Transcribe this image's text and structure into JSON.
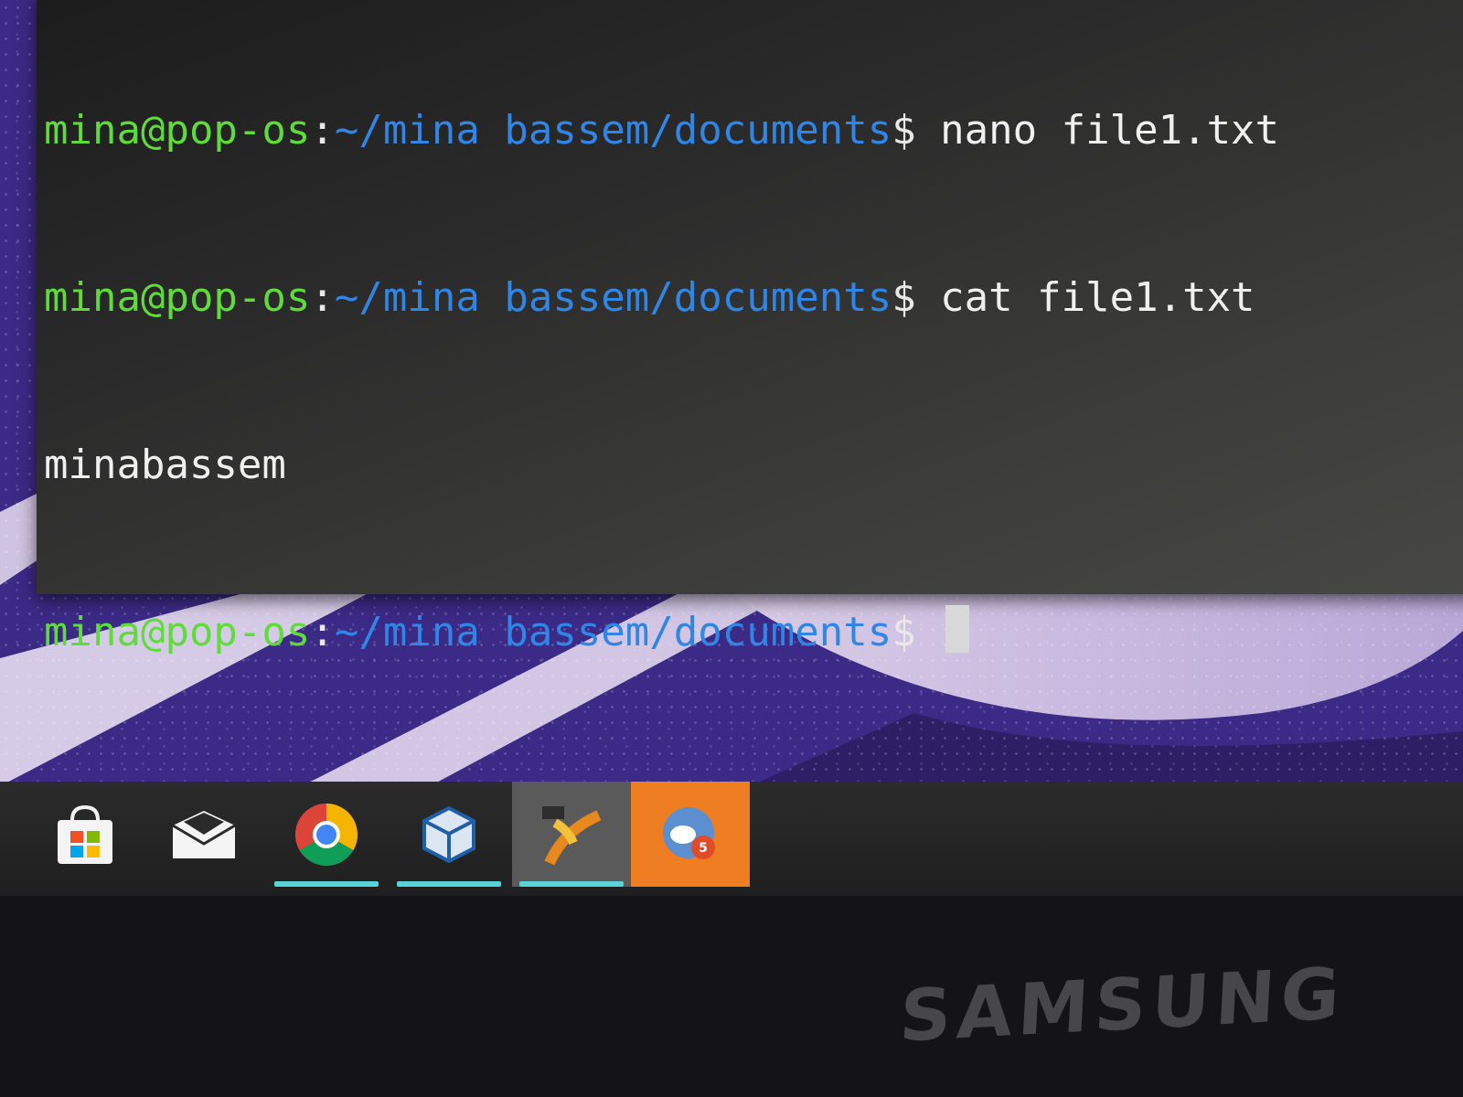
{
  "terminal": {
    "lines": [
      {
        "user": "mina@pop-os",
        "colon": ":",
        "path": "~/mina bassem/documents",
        "dollar": "$",
        "command": " nano file1.txt"
      },
      {
        "user": "mina@pop-os",
        "colon": ":",
        "path": "~/mina bassem/documents",
        "dollar": "$",
        "command": " cat file1.txt"
      },
      {
        "output": "minabassem"
      },
      {
        "user": "mina@pop-os",
        "colon": ":",
        "path": "~/mina bassem/documents",
        "dollar": "$",
        "command": " "
      }
    ]
  },
  "taskbar": {
    "items": [
      {
        "icon": "store-icon",
        "active": false
      },
      {
        "icon": "mail-icon",
        "active": false
      },
      {
        "icon": "chrome-icon",
        "active": true
      },
      {
        "icon": "virtualbox-icon",
        "active": true
      },
      {
        "icon": "codeblocks-icon",
        "active": true,
        "hovered": true
      },
      {
        "icon": "sync-app-icon",
        "active": false,
        "highlight": true
      }
    ]
  },
  "monitor": {
    "brand": "SAMSUNG"
  },
  "colors": {
    "prompt_user": "#5fdc3a",
    "prompt_path": "#2f86e6",
    "taskbar_indicator": "#5ad3d8",
    "orange_tile": "#ef7d22"
  }
}
